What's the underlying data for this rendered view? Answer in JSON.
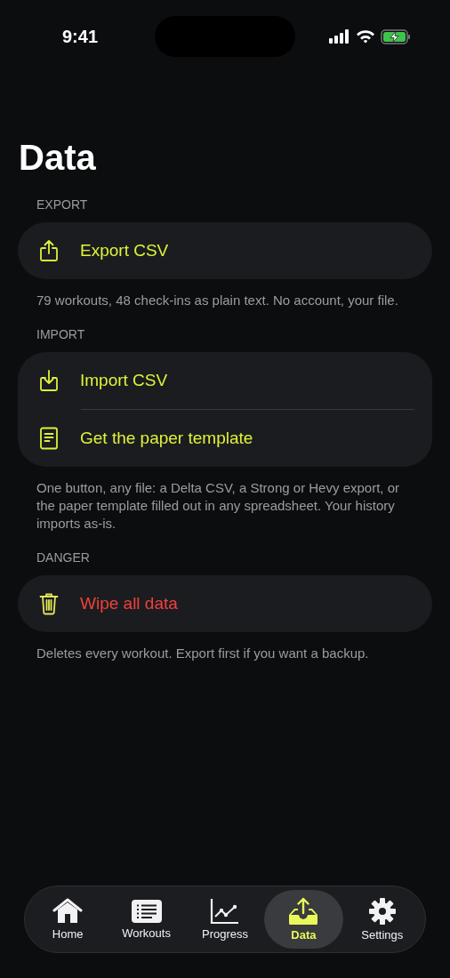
{
  "status_bar": {
    "time": "9:41"
  },
  "title": "Data",
  "sections": [
    {
      "header": "EXPORT",
      "items": [
        {
          "kind": "export",
          "label": "Export CSV",
          "destructive": false
        }
      ],
      "footer": "79 workouts, 48 check-ins as plain text. No account, your file."
    },
    {
      "header": "IMPORT",
      "items": [
        {
          "kind": "import",
          "label": "Import CSV",
          "destructive": false
        },
        {
          "kind": "template",
          "label": "Get the paper template",
          "destructive": false
        }
      ],
      "footer": "One button, any file: a Delta CSV, a Strong or Hevy export, or the paper template filled out in any spreadsheet. Your history imports as-is."
    },
    {
      "header": "DANGER",
      "items": [
        {
          "kind": "wipe",
          "label": "Wipe all data",
          "destructive": true
        }
      ],
      "footer": "Deletes every workout. Export first if you want a backup."
    }
  ],
  "tab_bar": [
    {
      "kind": "home",
      "label": "Home",
      "selected": false
    },
    {
      "kind": "workouts",
      "label": "Workouts",
      "selected": false
    },
    {
      "kind": "progress",
      "label": "Progress",
      "selected": false
    },
    {
      "kind": "data",
      "label": "Data",
      "selected": true
    },
    {
      "kind": "settings",
      "label": "Settings",
      "selected": false
    }
  ]
}
